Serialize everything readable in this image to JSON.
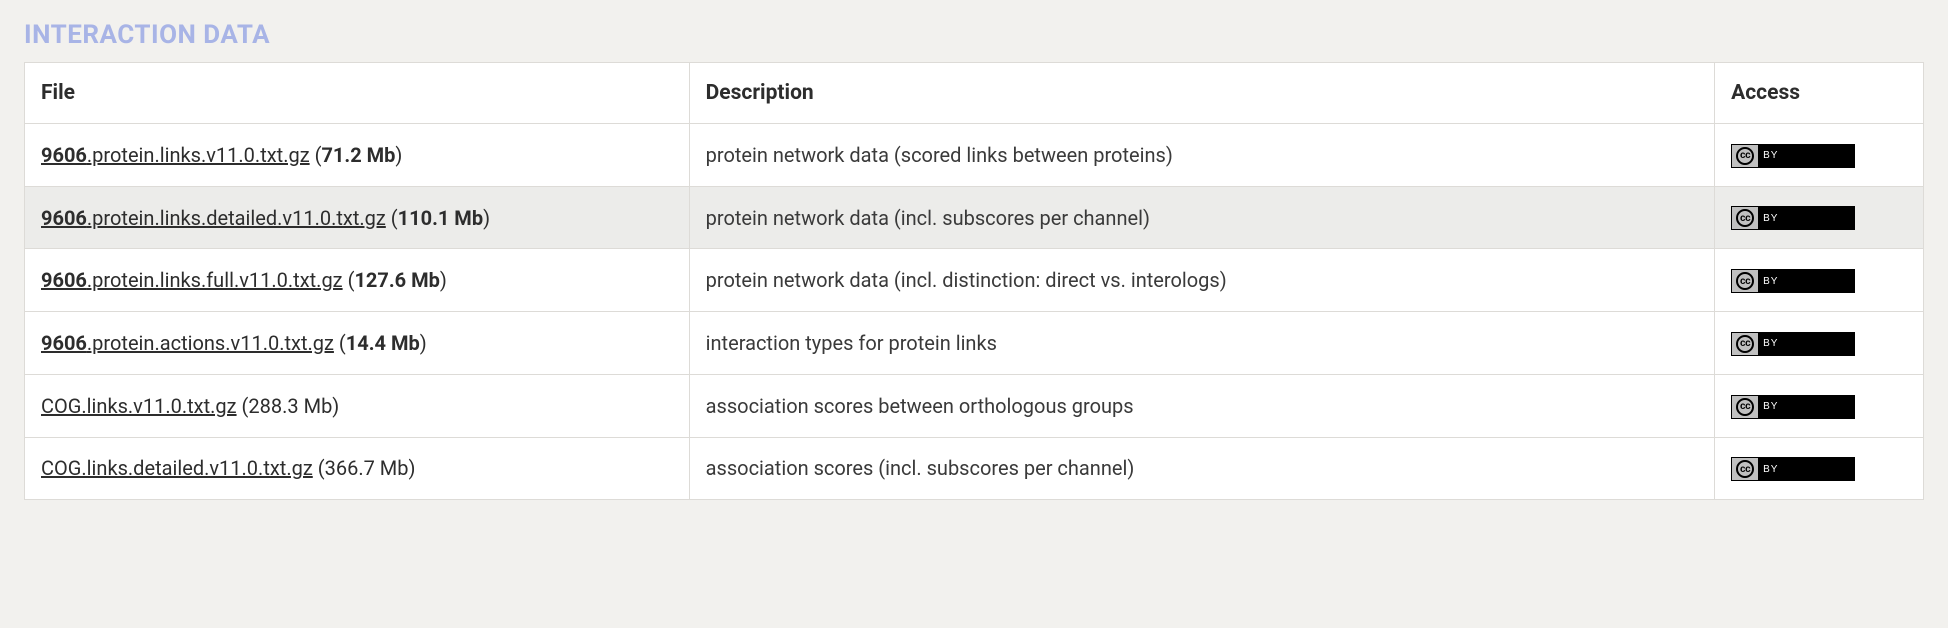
{
  "section": {
    "title": "INTERACTION DATA"
  },
  "table": {
    "headers": {
      "file": "File",
      "description": "Description",
      "access": "Access"
    },
    "rows": [
      {
        "file_prefix": "9606",
        "file_rest": ".protein.links.v11.0.txt.gz",
        "size": "71.2 Mb",
        "size_bold": true,
        "description": "protein network data (scored links between proteins)"
      },
      {
        "file_prefix": "9606",
        "file_rest": ".protein.links.detailed.v11.0.txt.gz",
        "size": "110.1 Mb",
        "size_bold": true,
        "description": "protein network data (incl. subscores per channel)"
      },
      {
        "file_prefix": "9606",
        "file_rest": ".protein.links.full.v11.0.txt.gz",
        "size": "127.6 Mb",
        "size_bold": true,
        "description": "protein network data (incl. distinction: direct vs. interologs)"
      },
      {
        "file_prefix": "9606",
        "file_rest": ".protein.actions.v11.0.txt.gz",
        "size": "14.4 Mb",
        "size_bold": true,
        "description": "interaction types for protein links"
      },
      {
        "file_prefix": "",
        "file_rest": "COG.links.v11.0.txt.gz",
        "size": "288.3 Mb",
        "size_bold": false,
        "description": "association scores between orthologous groups"
      },
      {
        "file_prefix": "",
        "file_rest": "COG.links.detailed.v11.0.txt.gz",
        "size": "366.7 Mb",
        "size_bold": false,
        "description": "association scores (incl. subscores per channel)"
      }
    ]
  },
  "license": {
    "cc_text": "cc",
    "by_text": "BY"
  }
}
